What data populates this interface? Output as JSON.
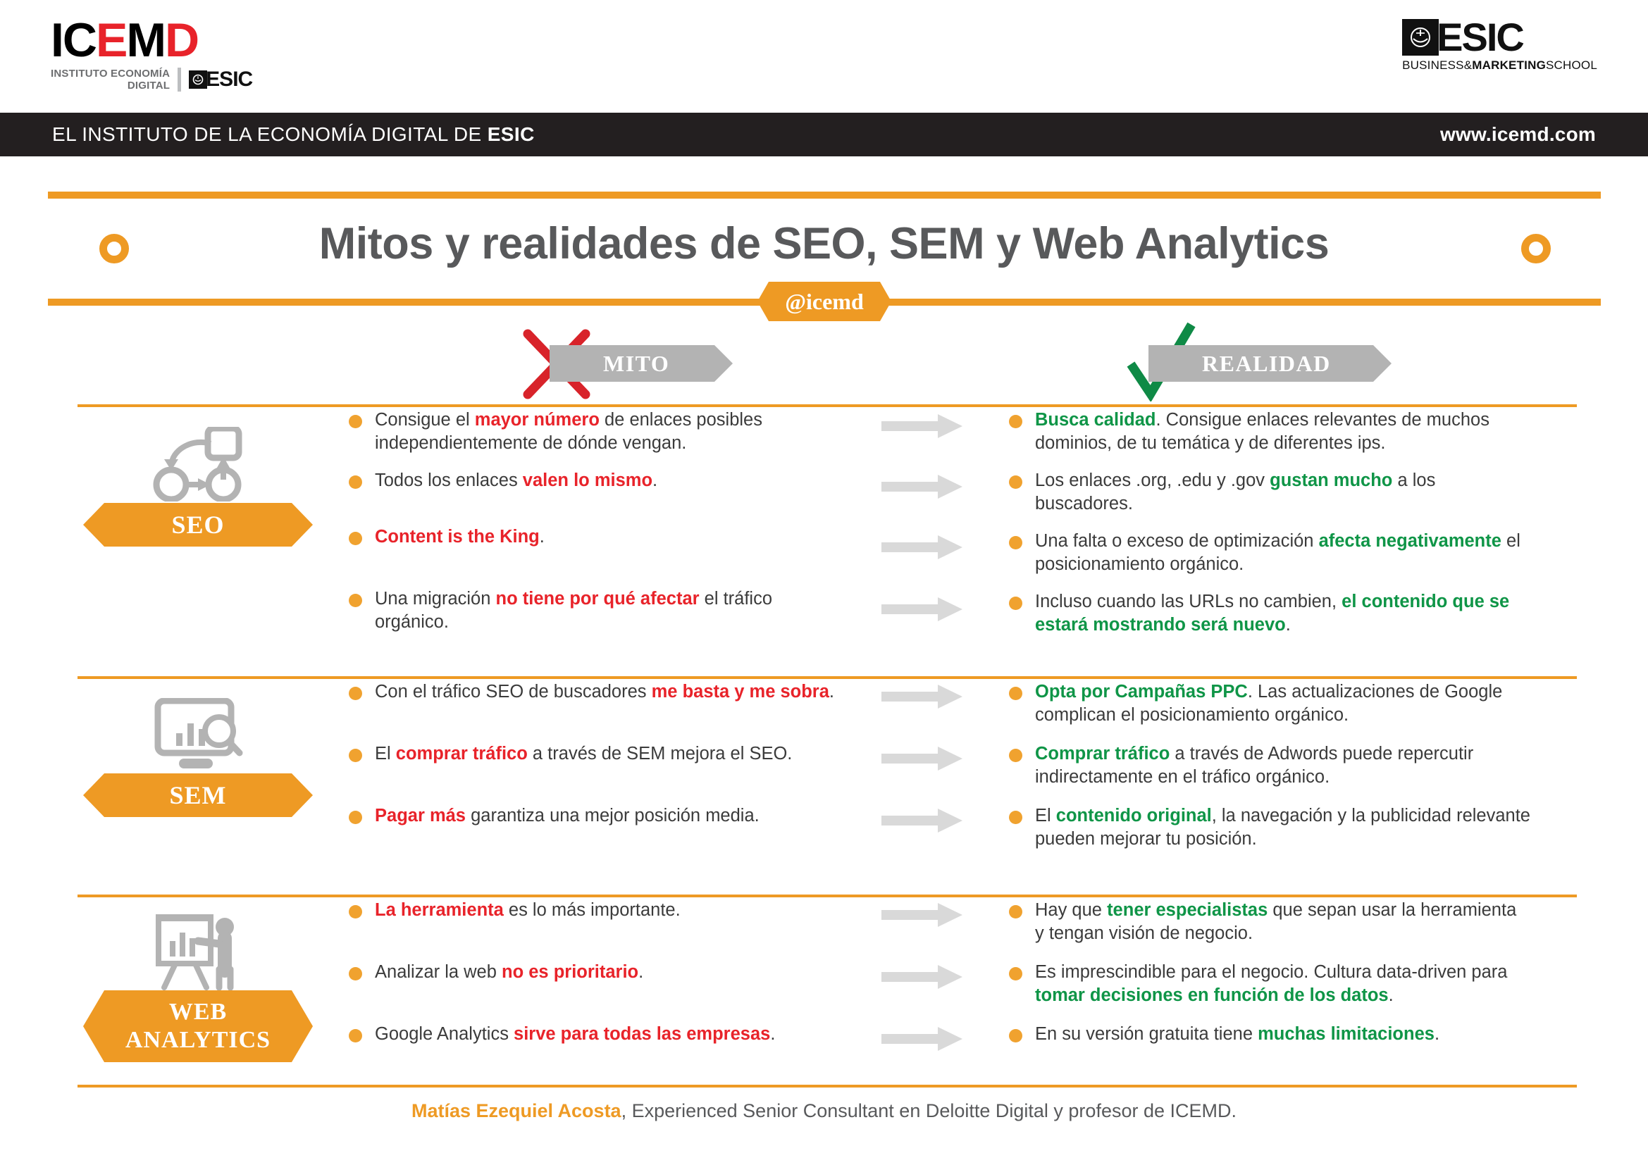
{
  "header": {
    "icemd_logo": {
      "part_black_1": "IC",
      "part_red_1": "E",
      "part_black_2": "M",
      "part_red_2": "D",
      "tagline_line1": "INSTITUTO ECONOMÍA",
      "tagline_line2": "DIGITAL",
      "partner": "ESIC"
    },
    "esic_logo": {
      "name": "ESIC",
      "tagline_plain_1": "BUSINESS&",
      "tagline_bold": "MARKETING",
      "tagline_plain_2": "SCHOOL"
    },
    "bar_left_plain": "EL INSTITUTO DE LA ECONOMÍA DIGITAL DE ",
    "bar_left_bold": "ESIC",
    "bar_right": "www.icemd.com"
  },
  "title": {
    "main": "Mitos y realidades de SEO, SEM y Web Analytics",
    "handle": "@icemd"
  },
  "columns": {
    "myth_label": "MITO",
    "reality_label": "REALIDAD",
    "myth_icon": "cross-x-icon",
    "reality_icon": "check-mark-icon"
  },
  "colors": {
    "orange": "#EE9A24",
    "red": "#E8232A",
    "green": "#0F9547",
    "gray_dark": "#58595B",
    "gray_chip": "#B3B3B3",
    "black_bar": "#231f20",
    "arrow_gray": "#D9D9D9"
  },
  "sections": [
    {
      "key": "seo",
      "label": "SEO",
      "icon": "network-flow-icon",
      "myths": [
        [
          {
            "t": "Consigue el ",
            "s": "n"
          },
          {
            "t": "mayor número",
            "s": "r"
          },
          {
            "t": " de enlaces posibles independientemente de dónde vengan.",
            "s": "n"
          }
        ],
        [
          {
            "t": "Todos los enlaces ",
            "s": "n"
          },
          {
            "t": "valen lo mismo",
            "s": "r"
          },
          {
            "t": ".",
            "s": "n"
          }
        ],
        [
          {
            "t": "Content is the King",
            "s": "r"
          },
          {
            "t": ".",
            "s": "n"
          }
        ],
        [
          {
            "t": "Una migración ",
            "s": "n"
          },
          {
            "t": "no tiene por qué afectar",
            "s": "r"
          },
          {
            "t": " el tráfico orgánico.",
            "s": "n"
          }
        ]
      ],
      "realities": [
        [
          {
            "t": "Busca calidad",
            "s": "g"
          },
          {
            "t": ". Consigue enlaces relevantes de muchos dominios, de tu temática y de diferentes ips.",
            "s": "n"
          }
        ],
        [
          {
            "t": "Los enlaces .org, .edu y .gov ",
            "s": "n"
          },
          {
            "t": "gustan mucho",
            "s": "g"
          },
          {
            "t": " a los buscadores.",
            "s": "n"
          }
        ],
        [
          {
            "t": "Una falta o exceso de optimización ",
            "s": "n"
          },
          {
            "t": "afecta negativamente",
            "s": "g"
          },
          {
            "t": " el posicionamiento orgánico.",
            "s": "n"
          }
        ],
        [
          {
            "t": "Incluso cuando las URLs no cambien, ",
            "s": "n"
          },
          {
            "t": "el contenido que se estará mostrando será nuevo",
            "s": "g"
          },
          {
            "t": ".",
            "s": "n"
          }
        ]
      ]
    },
    {
      "key": "sem",
      "label": "SEM",
      "icon": "monitor-chart-search-icon",
      "myths": [
        [
          {
            "t": "Con el tráfico SEO de buscadores ",
            "s": "n"
          },
          {
            "t": "me basta y me sobra",
            "s": "r"
          },
          {
            "t": ".",
            "s": "n"
          }
        ],
        [
          {
            "t": "El ",
            "s": "n"
          },
          {
            "t": "comprar tráfico",
            "s": "r"
          },
          {
            "t": " a través de SEM mejora el SEO.",
            "s": "n"
          }
        ],
        [
          {
            "t": "Pagar más",
            "s": "r"
          },
          {
            "t": " garantiza una mejor posición media.",
            "s": "n"
          }
        ]
      ],
      "realities": [
        [
          {
            "t": "Opta por Campañas PPC",
            "s": "g"
          },
          {
            "t": ". Las actualizaciones de Google complican el posicionamiento orgánico.",
            "s": "n"
          }
        ],
        [
          {
            "t": "Comprar tráfico",
            "s": "g"
          },
          {
            "t": " a través de Adwords puede repercutir indirectamente en el tráfico orgánico.",
            "s": "n"
          }
        ],
        [
          {
            "t": "El ",
            "s": "n"
          },
          {
            "t": "contenido original",
            "s": "g"
          },
          {
            "t": ", la navegación y la publicidad relevante pueden mejorar tu posición.",
            "s": "n"
          }
        ]
      ]
    },
    {
      "key": "web_analytics",
      "label": "WEB ANALYTICS",
      "label_line1": "WEB",
      "label_line2": "ANALYTICS",
      "icon": "presenter-flipchart-icon",
      "myths": [
        [
          {
            "t": "La herramienta",
            "s": "r"
          },
          {
            "t": " es lo más importante.",
            "s": "n"
          }
        ],
        [
          {
            "t": "Analizar la web ",
            "s": "n"
          },
          {
            "t": "no es prioritario",
            "s": "r"
          },
          {
            "t": ".",
            "s": "n"
          }
        ],
        [
          {
            "t": "Google Analytics ",
            "s": "n"
          },
          {
            "t": "sirve para todas las empresas",
            "s": "r"
          },
          {
            "t": ".",
            "s": "n"
          }
        ]
      ],
      "realities": [
        [
          {
            "t": "Hay que ",
            "s": "n"
          },
          {
            "t": "tener especialistas",
            "s": "g"
          },
          {
            "t": " que sepan usar la herramienta y tengan visión de negocio.",
            "s": "n"
          }
        ],
        [
          {
            "t": "Es imprescindible para el negocio. Cultura data-driven para ",
            "s": "n"
          },
          {
            "t": "tomar decisiones en función de los datos",
            "s": "g"
          },
          {
            "t": ".",
            "s": "n"
          }
        ],
        [
          {
            "t": "En su versión gratuita tiene ",
            "s": "n"
          },
          {
            "t": "muchas limitaciones",
            "s": "g"
          },
          {
            "t": ".",
            "s": "n"
          }
        ]
      ]
    }
  ],
  "footer": {
    "author": "Matías Ezequiel Acosta",
    "rest": ", Experienced Senior Consultant en Deloitte Digital y profesor de ICEMD."
  }
}
